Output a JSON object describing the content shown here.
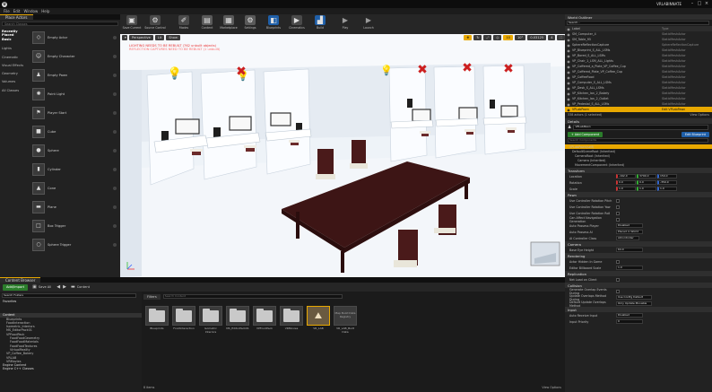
{
  "window": {
    "title": "VRLABINNATE",
    "menus": [
      "File",
      "Edit",
      "Window",
      "Help"
    ]
  },
  "tabs": {
    "place_actors": "Place Actors",
    "world_outliner": "World Outliner",
    "details": "Details",
    "content_browser": "Content Browser"
  },
  "modes": {
    "search_placeholder": "Search Classes",
    "categories": [
      "Recently Placed",
      "Basic",
      "Lights",
      "Cinematic",
      "Visual Effects",
      "Geometry",
      "Volumes",
      "All Classes"
    ],
    "items": [
      "Empty Actor",
      "Empty Character",
      "Empty Pawn",
      "Point Light",
      "Player Start",
      "Cube",
      "Sphere",
      "Cylinder",
      "Cone",
      "Plane",
      "Box Trigger",
      "Sphere Trigger"
    ]
  },
  "toolbar": {
    "buttons": [
      {
        "label": "Save Current",
        "icon": "save-icon"
      },
      {
        "label": "Source Control",
        "icon": "source-control-icon"
      },
      {
        "label": "Modes",
        "icon": "modes-icon"
      },
      {
        "label": "Content",
        "icon": "content-icon"
      },
      {
        "label": "Marketplace",
        "icon": "marketplace-icon"
      },
      {
        "label": "Settings",
        "icon": "settings-icon"
      },
      {
        "label": "Blueprints",
        "icon": "blueprints-icon"
      },
      {
        "label": "Cinematics",
        "icon": "cinematics-icon"
      },
      {
        "label": "Build",
        "icon": "build-icon"
      },
      {
        "label": "Play",
        "icon": "play-icon"
      },
      {
        "label": "Launch",
        "icon": "launch-icon"
      }
    ]
  },
  "viewport": {
    "view_mode": "Perspective",
    "lit": "Lit",
    "show": "Show",
    "error_line1": "LIGHTING NEEDS TO BE REBUILT (762 unbuilt objects)",
    "error_line2": "REFLECTION CAPTURES NEED TO BE REBUILT (1 unbuilt)",
    "grid": "10",
    "rot": "10°",
    "scale": "0.03125",
    "cam": "4",
    "light_ok": "light-bulb-icon",
    "light_bad": "light-error-icon"
  },
  "outliner": {
    "search_placeholder": "Search...",
    "col_label": "Label",
    "col_type": "Type",
    "rows": [
      {
        "name": "SM_Computer_4",
        "type": "StaticMeshActor"
      },
      {
        "name": "SM_Table_95",
        "type": "StaticMeshActor"
      },
      {
        "name": "SphereReflectionCapture",
        "type": "SphereReflectionCapture"
      },
      {
        "name": "VP_Blueprint_S_ALL_LSMs",
        "type": "StaticMeshActor"
      },
      {
        "name": "VP_Bored_S_ALL_LSMs",
        "type": "StaticMeshActor"
      },
      {
        "name": "VP_Chair_1_LSM_ALL_Lights",
        "type": "StaticMeshActor"
      },
      {
        "name": "VP_Coffered_a_Plate_VP_Coffee_Cup",
        "type": "StaticMeshActor"
      },
      {
        "name": "VP_Coffered_Plate_VP_Coffee_Cup",
        "type": "StaticMeshActor"
      },
      {
        "name": "VP_CoffeeFood",
        "type": "StaticMeshActor"
      },
      {
        "name": "VP_Computer_S_ALL_LSMs",
        "type": "StaticMeshActor"
      },
      {
        "name": "VP_Desk_S_ALL_LSMs",
        "type": "StaticMeshActor"
      },
      {
        "name": "VP_Kitchen_Ian_2_Bakely",
        "type": "StaticMeshActor"
      },
      {
        "name": "VP_Kitchen_Ian_2_Outlet",
        "type": "StaticMeshActor"
      },
      {
        "name": "VP_Pedestal_S_ALL_LSMs",
        "type": "StaticMeshActor"
      },
      {
        "name": "VPLabPawn",
        "type": "Edit VPLabPawn"
      }
    ],
    "footer": "338 actors (1 selected)",
    "view_options": "View Options"
  },
  "details": {
    "actor_name": "VPLabPawn",
    "add_component": "+ Add Component",
    "edit_blueprint": "Edit Blueprint",
    "search_placeholder": "Search Components",
    "components": [
      "VPLabPawn(self)",
      "DefaultSceneRoot (Inherited)",
      "CameraRoot (Inherited)",
      "Camera (Inherited)",
      "MovementComponent (Inherited)"
    ],
    "transform": "Transform",
    "location": {
      "label": "Location",
      "x": "-192.0",
      "y": "3790.0",
      "z": "150.0"
    },
    "rotation": {
      "label": "Rotation",
      "x": "0.0",
      "y": "0.0",
      "z": "-359.9"
    },
    "scale": {
      "label": "Scale",
      "x": "1.0",
      "y": "1.0",
      "z": "1.0"
    },
    "pawn": "Pawn",
    "pawn_props": [
      "Use Controller Rotation Pitch",
      "Use Controller Rotation Yaw",
      "Use Controller Rotation Roll",
      "Can Affect Navigation Generation"
    ],
    "auto_possess_player": {
      "label": "Auto Possess Player",
      "value": "Disabled"
    },
    "auto_possess_ai": {
      "label": "Auto Possess AI",
      "value": "Placed in World"
    },
    "ai_controller": {
      "label": "AI Controller Class",
      "value": "AIController"
    },
    "camera": "Camera",
    "base_eye": {
      "label": "Base Eye Height",
      "value": "64.0"
    },
    "rendering": "Rendering",
    "actor_hidden": "Actor Hidden In Game",
    "billboard": {
      "label": "Editor Billboard Scale",
      "value": "1.0"
    },
    "replication": "Replication",
    "net_load": "Net Load on Client",
    "collision": "Collision",
    "gen_overlap": "Generate Overlap Events During",
    "update_overlap": {
      "label": "Update Overlaps Method During",
      "value": "Use Config Default"
    },
    "default_update": {
      "label": "Default Update Overlaps Method",
      "value": "Only Update Movable"
    },
    "input": "Input",
    "auto_receive": {
      "label": "Auto Receive Input",
      "value": "Disabled"
    },
    "input_priority": {
      "label": "Input Priority",
      "value": "0"
    }
  },
  "content_browser": {
    "add_import": "Add/Import",
    "save_all": "Save All",
    "breadcrumb": "Content",
    "filters": "Filters",
    "search_placeholder": "Search Content",
    "tree_search_placeholder": "Search Folders",
    "favorites": "Favorites",
    "tree": [
      "Content",
      "Blueprints",
      "FoodInteraction",
      "Isometric_Interiors",
      "MS_EditorPack01",
      "VPFoodPack",
      "FoodFoodGeometry",
      "FoodFoodMaterials",
      "FoodFoodTextures",
      "VirtualReality",
      "VP_Coffee_Bakery",
      "VRLAB",
      "VRMovies",
      "Engine Content",
      "Engine C++ Classes"
    ],
    "assets": [
      {
        "name": "Blueprints",
        "kind": "folder"
      },
      {
        "name": "FoodInteraction",
        "kind": "folder"
      },
      {
        "name": "Isometric Interiors",
        "kind": "folder"
      },
      {
        "name": "MS_EditorPack01",
        "kind": "folder"
      },
      {
        "name": "VPFoodPack",
        "kind": "folder"
      },
      {
        "name": "VRMovies",
        "kind": "folder"
      },
      {
        "name": "VR_LAB",
        "kind": "level"
      },
      {
        "name": "VR_LAB_Built Data",
        "kind": "data"
      }
    ],
    "asset_thumb_text": "Map Build Data Registry",
    "item_count": "8 items",
    "view_options": "View Options"
  },
  "colors": {
    "accent": "#e8a800",
    "select_blue": "#1f5fa8",
    "error_red": "#e83030"
  }
}
